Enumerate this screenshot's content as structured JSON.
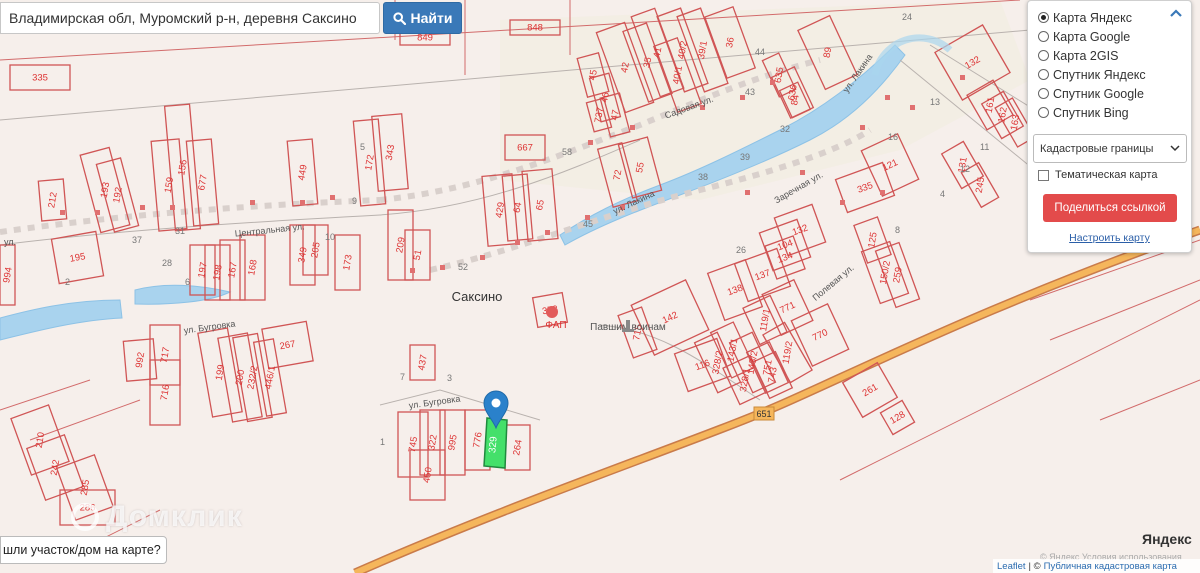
{
  "search": {
    "value": "Владимирская обл, Муромский р-н, деревня Саксино",
    "button_label": "Найти"
  },
  "layers": {
    "options": [
      {
        "label": "Карта Яндекс",
        "selected": true
      },
      {
        "label": "Карта Google",
        "selected": false
      },
      {
        "label": "Карта 2GIS",
        "selected": false
      },
      {
        "label": "Спутник Яндекс",
        "selected": false
      },
      {
        "label": "Спутник Google",
        "selected": false
      },
      {
        "label": "Спутник Bing",
        "selected": false
      }
    ],
    "overlay_select": "Кадастровые границы",
    "thematic_label": "Тематическая карта",
    "share_label": "Поделиться ссылкой",
    "configure_label": "Настроить карту"
  },
  "found_button": "шли участок/дом на карте?",
  "watermark": "Домклик",
  "yandex_logo": "Яндекс",
  "attribution": {
    "leaflet": "Leaflet",
    "separator": "| ©",
    "source": "Публичная кадастровая карта",
    "terms": "© Яндекс  Условия использования"
  },
  "map": {
    "locality": "Саксино",
    "streets": [
      "Центральная ул.",
      "ул. Бугровка",
      "ул. Бугровка",
      "Садовая ул.",
      "ул. Лакина",
      "ул. Лакина",
      "Заречная ул.",
      "Полевая ул.",
      "ул.",
      "Павшим воинам",
      "ФАП"
    ],
    "road_number": "651",
    "highlight_parcel": "329",
    "parcels": [
      "335",
      "849",
      "848",
      "212",
      "193",
      "192",
      "159",
      "156",
      "677",
      "172",
      "343",
      "449",
      "667",
      "429",
      "64",
      "65",
      "72",
      "55",
      "45",
      "46",
      "737",
      "47",
      "42",
      "35",
      "41",
      "40/2",
      "39/1",
      "40/1",
      "36",
      "635",
      "636",
      "84",
      "89",
      "132",
      "161",
      "162",
      "163",
      "131",
      "245",
      "121",
      "335",
      "132",
      "104",
      "134",
      "125",
      "150/2",
      "259",
      "137",
      "138",
      "771",
      "119/1",
      "119/2",
      "770",
      "143/1",
      "143/2",
      "751",
      "328/2",
      "328/1",
      "743",
      "116",
      "142",
      "373",
      "715",
      "195",
      "197",
      "198",
      "167",
      "168",
      "349",
      "205",
      "173",
      "209",
      "51",
      "994",
      "992",
      "717",
      "716",
      "267",
      "199",
      "200",
      "232/2",
      "446/1",
      "437",
      "745",
      "322",
      "995",
      "776",
      "264",
      "450",
      "210",
      "242",
      "285",
      "286",
      "261",
      "128"
    ],
    "numbers": [
      "24",
      "44",
      "43",
      "32",
      "39",
      "38",
      "58",
      "9",
      "52",
      "45",
      "5",
      "13",
      "16",
      "4",
      "8",
      "12",
      "11",
      "10",
      "31",
      "37",
      "28",
      "7",
      "3",
      "1",
      "6",
      "2",
      "26"
    ]
  }
}
